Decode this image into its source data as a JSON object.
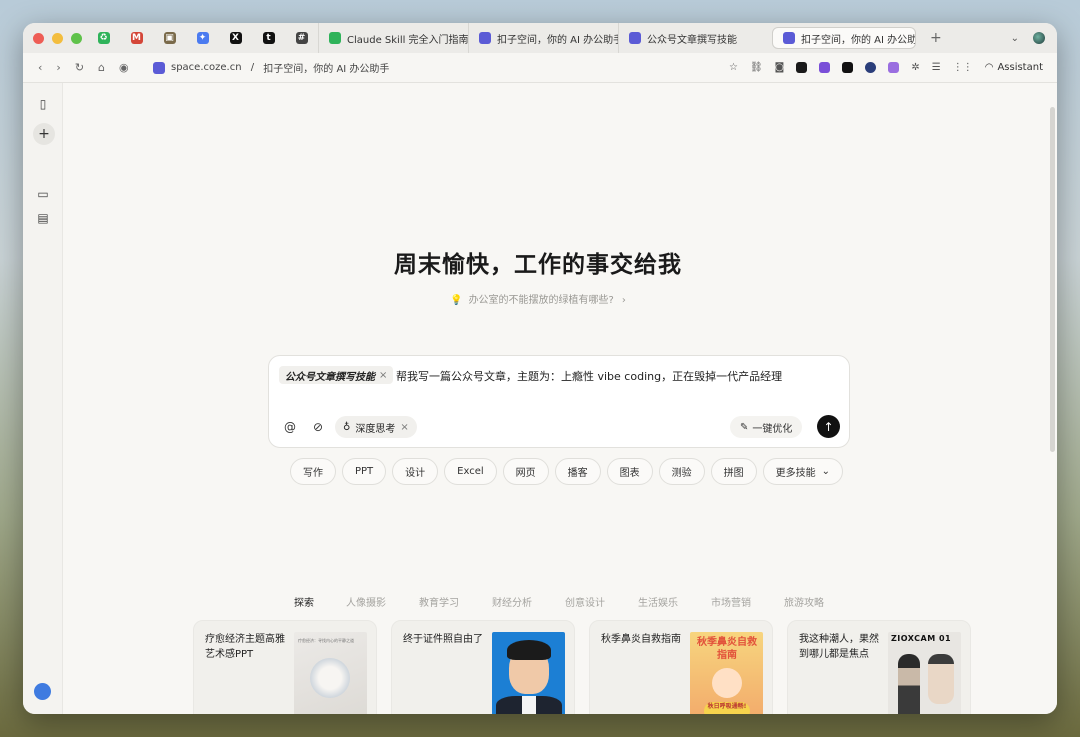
{
  "browser": {
    "pinned_tabs": [
      {
        "name": "recycle",
        "color": "#2fb35a",
        "glyph": "♻"
      },
      {
        "name": "gmail",
        "color": "#d44638",
        "glyph": "M"
      },
      {
        "name": "doc",
        "color": "#7a6a4a",
        "glyph": "▣"
      },
      {
        "name": "gemini",
        "color": "#4b7bf0",
        "glyph": "✦"
      },
      {
        "name": "x",
        "color": "#111111",
        "glyph": "X"
      },
      {
        "name": "tldr",
        "color": "#111111",
        "glyph": "t"
      },
      {
        "name": "slack",
        "color": "#444444",
        "glyph": "#"
      }
    ],
    "tabs": [
      {
        "label": "Claude Skill 完全入门指南",
        "color": "#2fb35a",
        "active": false
      },
      {
        "label": "扣子空间，你的 AI 办公助手",
        "color": "#5b5bd6",
        "active": false
      },
      {
        "label": "公众号文章撰写技能",
        "color": "#5b5bd6",
        "active": false
      },
      {
        "label": "扣子空间，你的 AI 办公助手",
        "color": "#5b5bd6",
        "active": true
      }
    ],
    "new_tab": "+",
    "url_domain": "space.coze.cn",
    "url_sep": " / ",
    "url_title": "扣子空间，你的 AI 办公助手",
    "assistant_label": "Assistant"
  },
  "main": {
    "headline": "周末愉快，工作的事交给我",
    "hint": "办公室的不能摆放的绿植有哪些?",
    "input": {
      "skill_chip": "公众号文章撰写技能",
      "prompt": "帮我写一篇公众号文章，主题为：上瘾性 vibe coding，正在毁掉一代产品经理",
      "deep_think": "深度思考",
      "optimize": "一键优化"
    },
    "skills": [
      "写作",
      "PPT",
      "设计",
      "Excel",
      "网页",
      "播客",
      "图表",
      "测验",
      "拼图",
      "更多技能"
    ],
    "categories": [
      "探索",
      "人像摄影",
      "教育学习",
      "财经分析",
      "创意设计",
      "生活娱乐",
      "市场营销",
      "旅游攻略"
    ],
    "cards": [
      {
        "text": "疗愈经济主题高雅艺术感PPT",
        "thumb_title": "疗愈经济：寻找内心的平静之道"
      },
      {
        "text": "终于证件照自由了"
      },
      {
        "text": "秋季鼻炎自救指南",
        "thumb_title": "秋季鼻炎自救指南",
        "thumb_badge": "秋日呼吸通畅!"
      },
      {
        "text": "我这种潮人，果然到哪儿都是焦点",
        "thumb_title": "ZIOXCAM 01"
      }
    ]
  }
}
